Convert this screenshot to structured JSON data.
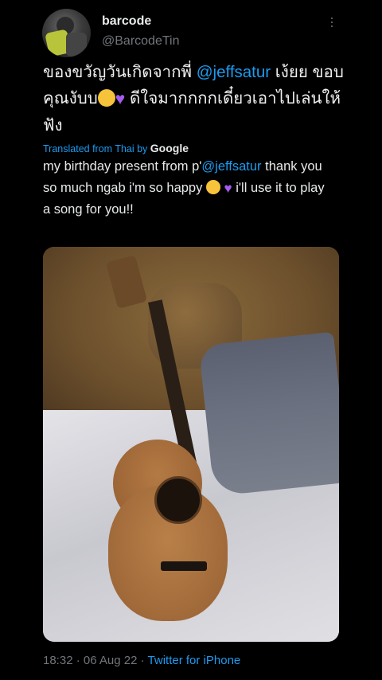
{
  "tweet": {
    "author_name": "barcode",
    "author_handle": "@BarcodeTin",
    "text_part1": "ของขวัญวันเกิดจากพี่ ",
    "mention": "@jeffsatur",
    "text_part2": " เง้ยย ขอบคุณงับบ",
    "text_part3": " ดีใจมากกกกเดี๋ยวเอาไปเล่นให้ฟัง",
    "translated_label": "Translated from Thai by ",
    "translator": "Google",
    "translation_part1": "my birthday present from p'",
    "translation_mention": "@jeffsatur",
    "translation_part2": " thank you so much ngab i'm so happy ",
    "translation_part3": " i'll use it to play a song for you!!",
    "time": "18:32",
    "date": "06 Aug 22",
    "separator": "·",
    "source": "Twitter for iPhone"
  },
  "icons": {
    "more": "more-vertical-icon",
    "laugh_emoji": "grinning-squinting-face",
    "heart_emoji": "purple-heart"
  },
  "colors": {
    "background": "#000000",
    "link": "#1d9bf0",
    "secondary": "#71767b",
    "text": "#e7e9ea"
  }
}
